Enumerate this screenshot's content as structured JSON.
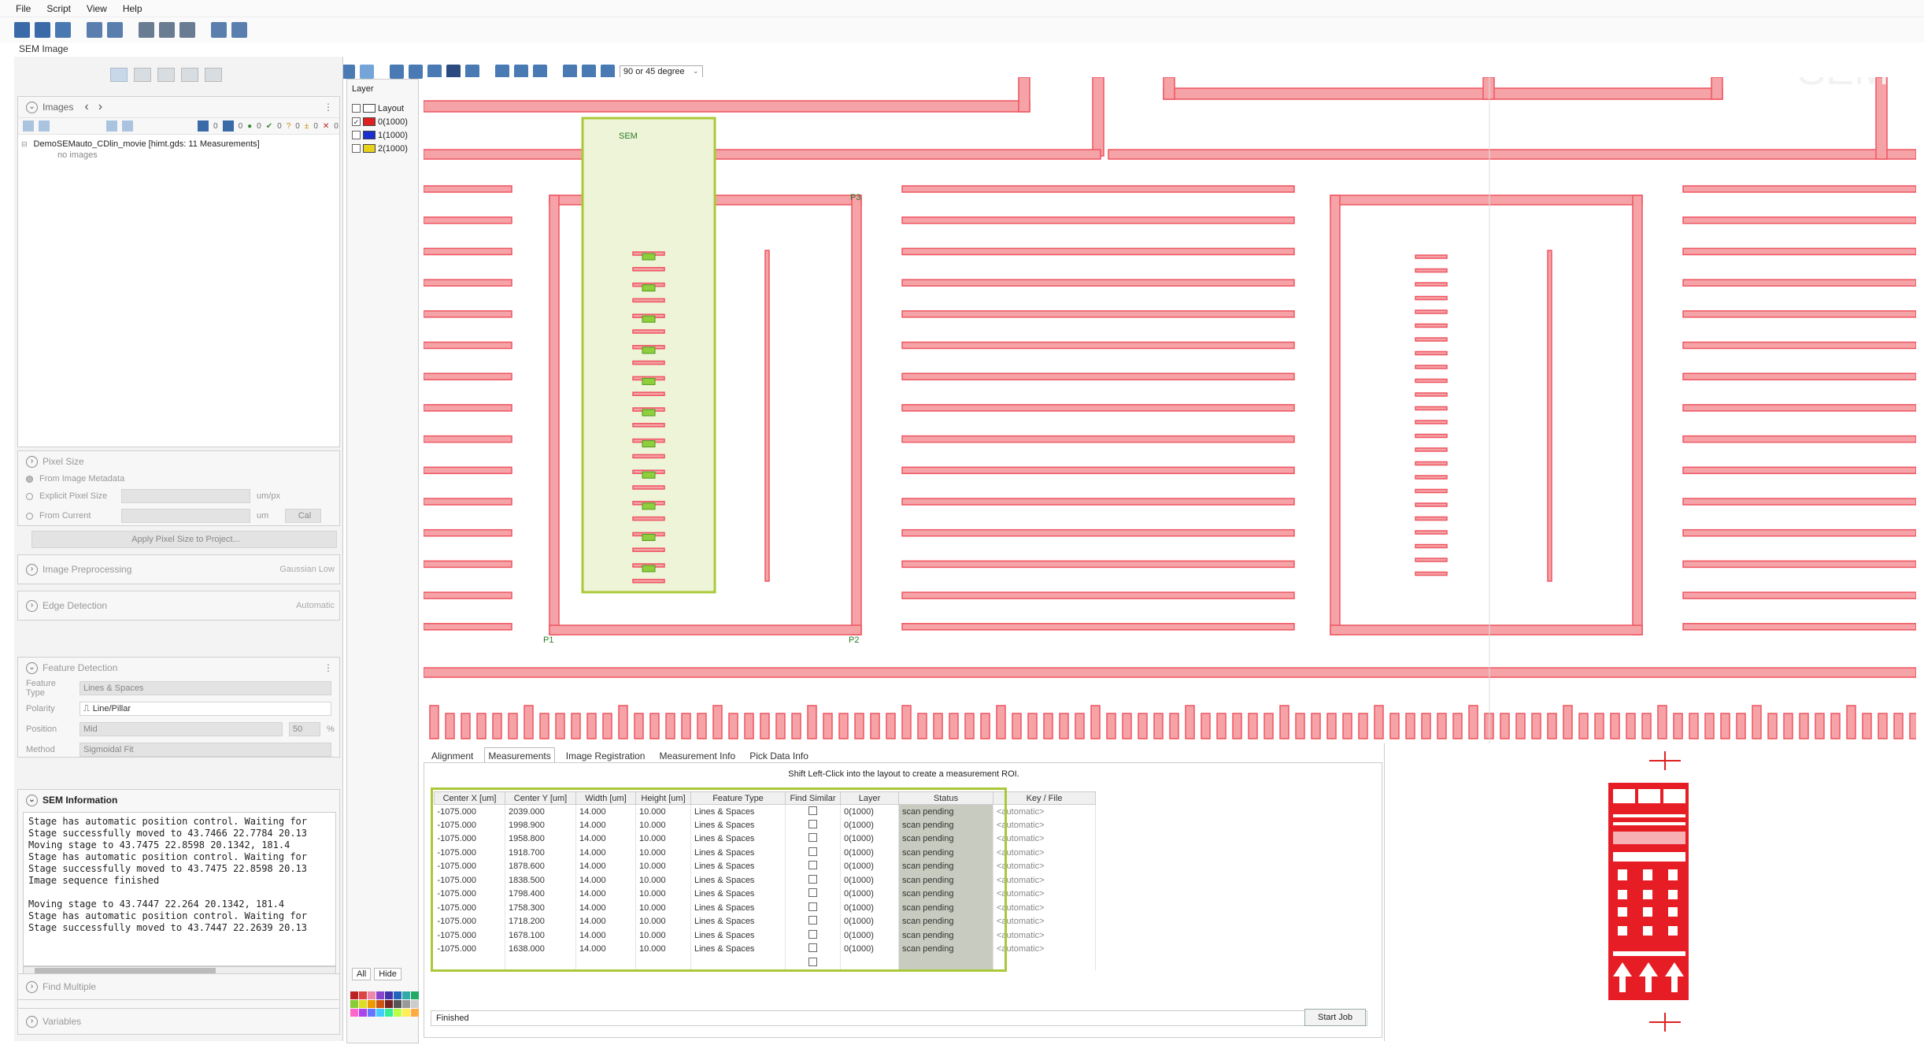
{
  "menu": {
    "file": "File",
    "script": "Script",
    "view": "View",
    "help": "Help"
  },
  "doc_title": "SEM Image",
  "toolbar2": {
    "angle_select": "90 or 45 degree"
  },
  "watermark": "SEM",
  "images_panel": {
    "title": "Images",
    "project": "DemoSEMauto_CDlin_movie [himt.gds: 11 Measurements]",
    "no_images": "no images",
    "counters": [
      "0",
      "0",
      "0",
      "0",
      "0",
      "0",
      "0"
    ]
  },
  "pixel_size": {
    "title": "Pixel Size",
    "from_metadata": "From Image Metadata",
    "explicit": "Explicit Pixel Size",
    "explicit_unit": "um/px",
    "from_current": "From Current",
    "current_unit": "um",
    "cal_button": "Cal",
    "apply_button": "Apply Pixel Size to Project..."
  },
  "preprocessing": {
    "title": "Image Preprocessing",
    "value": "Gaussian Low"
  },
  "edge_detection": {
    "title": "Edge Detection",
    "value": "Automatic"
  },
  "feature_detection": {
    "title": "Feature Detection",
    "feature_type_label": "Feature Type",
    "feature_type": "Lines & Spaces",
    "polarity_label": "Polarity",
    "polarity": "Line/Pillar",
    "position_label": "Position",
    "position": "Mid",
    "position_value": "50",
    "position_unit": "%",
    "method_label": "Method",
    "method": "Sigmoidal Fit"
  },
  "sem_info": {
    "title": "SEM Information",
    "log": "Stage has automatic position control. Waiting for\nStage successfully moved to 43.7466 22.7784 20.13\nMoving stage to 43.7475 22.8598 20.1342, 181.4\nStage has automatic position control. Waiting for\nStage successfully moved to 43.7475 22.8598 20.13\nImage sequence finished\n\nMoving stage to 43.7447 22.264 20.1342, 181.4\nStage has automatic position control. Waiting for\nStage successfully moved to 43.7447 22.2639 20.13"
  },
  "find_multiple": {
    "title": "Find Multiple"
  },
  "variables": {
    "title": "Variables"
  },
  "layer_panel": {
    "header": "Layer",
    "layers": [
      {
        "name": "Layout",
        "color": "#ffffff",
        "checked": false
      },
      {
        "name": "0(1000)",
        "color": "#e02020",
        "checked": true
      },
      {
        "name": "1(1000)",
        "color": "#1a2fd0",
        "checked": false
      },
      {
        "name": "2(1000)",
        "color": "#e6d21a",
        "checked": false
      }
    ],
    "all_button": "All",
    "hide_button": "Hide"
  },
  "canvas": {
    "sem_label": "SEM",
    "p1": "P1",
    "p2": "P2",
    "p3": "P3"
  },
  "tabs": [
    "Alignment",
    "Measurements",
    "Image Registration",
    "Measurement Info",
    "Pick Data Info"
  ],
  "measurements": {
    "hint": "Shift Left-Click into the layout to create a measurement ROI.",
    "columns": [
      "Center X [um]",
      "Center Y [um]",
      "Width [um]",
      "Height [um]",
      "Feature Type",
      "Find Similar",
      "Layer",
      "Status",
      "Key / File"
    ],
    "rows": [
      [
        "-1075.000",
        "2039.000",
        "14.000",
        "10.000",
        "Lines & Spaces",
        "0(1000)",
        "scan pending",
        "<automatic>"
      ],
      [
        "-1075.000",
        "1998.900",
        "14.000",
        "10.000",
        "Lines & Spaces",
        "0(1000)",
        "scan pending",
        "<automatic>"
      ],
      [
        "-1075.000",
        "1958.800",
        "14.000",
        "10.000",
        "Lines & Spaces",
        "0(1000)",
        "scan pending",
        "<automatic>"
      ],
      [
        "-1075.000",
        "1918.700",
        "14.000",
        "10.000",
        "Lines & Spaces",
        "0(1000)",
        "scan pending",
        "<automatic>"
      ],
      [
        "-1075.000",
        "1878.600",
        "14.000",
        "10.000",
        "Lines & Spaces",
        "0(1000)",
        "scan pending",
        "<automatic>"
      ],
      [
        "-1075.000",
        "1838.500",
        "14.000",
        "10.000",
        "Lines & Spaces",
        "0(1000)",
        "scan pending",
        "<automatic>"
      ],
      [
        "-1075.000",
        "1798.400",
        "14.000",
        "10.000",
        "Lines & Spaces",
        "0(1000)",
        "scan pending",
        "<automatic>"
      ],
      [
        "-1075.000",
        "1758.300",
        "14.000",
        "10.000",
        "Lines & Spaces",
        "0(1000)",
        "scan pending",
        "<automatic>"
      ],
      [
        "-1075.000",
        "1718.200",
        "14.000",
        "10.000",
        "Lines & Spaces",
        "0(1000)",
        "scan pending",
        "<automatic>"
      ],
      [
        "-1075.000",
        "1678.100",
        "14.000",
        "10.000",
        "Lines & Spaces",
        "0(1000)",
        "scan pending",
        "<automatic>"
      ],
      [
        "-1075.000",
        "1638.000",
        "14.000",
        "10.000",
        "Lines & Spaces",
        "0(1000)",
        "scan pending",
        "<automatic>"
      ]
    ],
    "status_text": "Finished",
    "start_button": "Start Job"
  },
  "colors": {
    "layout_red": "#ee5560",
    "layout_fill": "#f6a3a8",
    "roi_green": "#a9c938",
    "roi_fill": "#eef4d8"
  }
}
